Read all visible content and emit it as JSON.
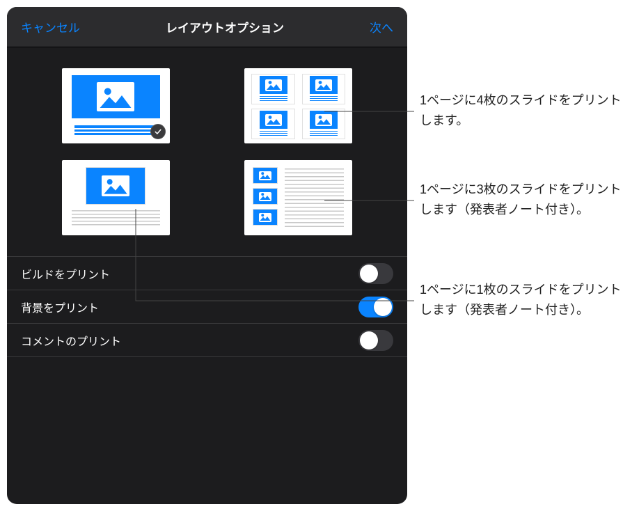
{
  "header": {
    "cancel": "キャンセル",
    "title": "レイアウトオプション",
    "next": "次へ"
  },
  "layouts": {
    "selected": 0
  },
  "settings": [
    {
      "label": "ビルドをプリント",
      "on": false
    },
    {
      "label": "背景をプリント",
      "on": true
    },
    {
      "label": "コメントのプリント",
      "on": false
    }
  ],
  "callouts": [
    "1ページに4枚のスライドをプリントします。",
    "1ページに3枚のスライドをプリントします（発表者ノート付き）。",
    "1ページに1枚のスライドをプリントします（発表者ノート付き）。"
  ]
}
